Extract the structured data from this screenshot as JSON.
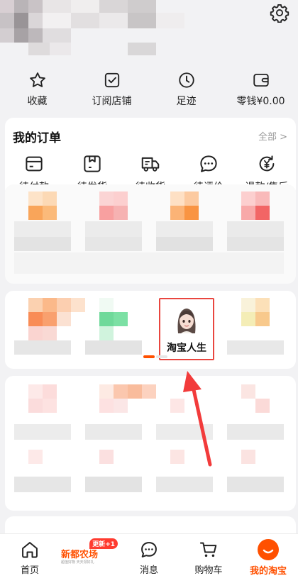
{
  "quickbar": [
    {
      "label": "收藏",
      "icon": "star-icon"
    },
    {
      "label": "订阅店铺",
      "icon": "checkbox-icon"
    },
    {
      "label": "足迹",
      "icon": "clock-icon"
    },
    {
      "label": "零钱¥0.00",
      "icon": "wallet-icon"
    }
  ],
  "orders": {
    "title": "我的订单",
    "all": "全部 >",
    "items": [
      {
        "label": "待付款",
        "icon": "card-icon"
      },
      {
        "label": "待发货",
        "icon": "box-icon"
      },
      {
        "label": "待收货",
        "icon": "truck-icon"
      },
      {
        "label": "待评价",
        "icon": "chat-bubble-icon"
      },
      {
        "label": "退款/售后",
        "icon": "refund-icon"
      }
    ]
  },
  "life": {
    "label": "淘宝人生"
  },
  "tabbar": {
    "items": [
      {
        "label": "首页",
        "icon": "home-icon"
      },
      {
        "label": "",
        "icon": "promo-banner"
      },
      {
        "label": "消息",
        "icon": "message-icon"
      },
      {
        "label": "购物车",
        "icon": "cart-icon"
      },
      {
        "label": "我的淘宝",
        "icon": "taobao-face-icon"
      }
    ],
    "promo": {
      "title": "新都农场",
      "badge": "更新+1",
      "sub": "超值好物 天天领好礼"
    }
  },
  "colors": {
    "accent": "#ff5000",
    "highlight": "#e9463f"
  }
}
